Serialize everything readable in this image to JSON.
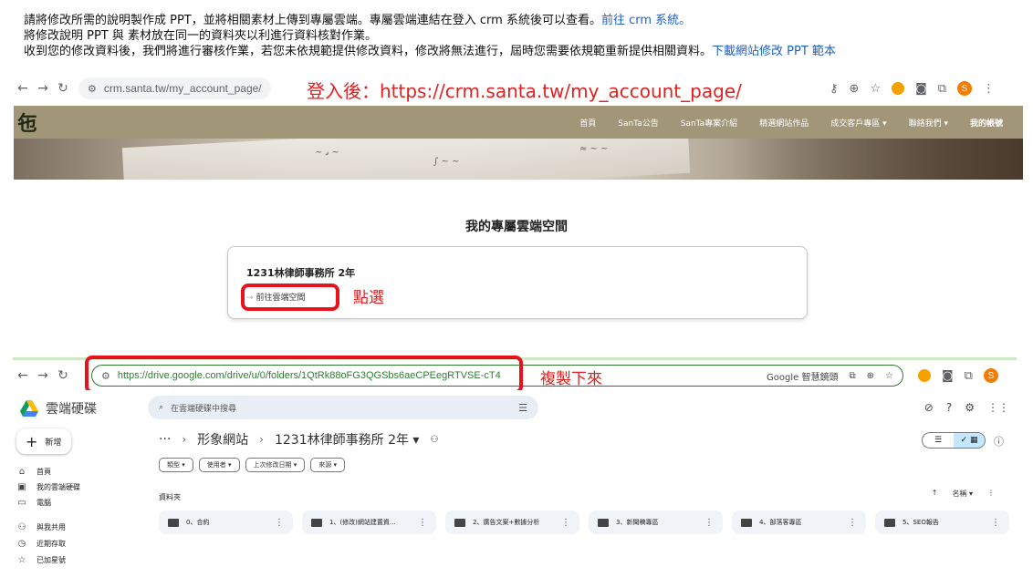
{
  "instructions": {
    "line1_text": "請將修改所需的說明製作成 PPT，並將相關素材上傳到專屬雲端。專屬雲端連結在登入 crm 系統後可以查看。",
    "line1_link": "前往 crm 系統。",
    "line2_text": "將修改說明 PPT 與 素材放在同一的資料夾以利進行資料核對作業。",
    "line3_text": "收到您的修改資料後，我們將進行審核作業，若您未依規範提供修改資料，修改將無法進行，屆時您需要依規範重新提供相關資料。",
    "line3_link": "下載網站修改 PPT 範本"
  },
  "crm_browser": {
    "url": "crm.santa.tw/my_account_page/",
    "annotation": "登入後：https://crm.santa.tw/my_account_page/",
    "avatar_letter": "S"
  },
  "santa_site": {
    "logo": "㐌",
    "menu": [
      "首頁",
      "SanTa公告",
      "SanTa專案介紹",
      "精選網站作品",
      "成交客戶專區 ▾",
      "聯絡我們 ▾",
      "我的帳號"
    ],
    "hero_scribbles": [
      "~ 𝓈 ~",
      "∫ ~ ~",
      "≈ ~ ~"
    ],
    "section_title": "我的專屬雲端空間",
    "card_title": "1231林律師事務所 2年",
    "card_link": "前往雲端空間",
    "card_annotation": "點選"
  },
  "drive_browser": {
    "url": "https://drive.google.com/drive/u/0/folders/1QtRk88oFG3QGSbs6aeCPEegRTVSE-cT4",
    "annotation": "複製下來",
    "google_search": "Google 智慧鏡頭",
    "avatar_letter": "S"
  },
  "drive": {
    "app_name": "雲端硬碟",
    "search_placeholder": "在雲端硬碟中搜尋",
    "new_label": "新增",
    "sidebar": [
      {
        "icon": "⌂",
        "label": "首頁"
      },
      {
        "icon": "▣",
        "label": "我的雲端硬碟"
      },
      {
        "icon": "▭",
        "label": "電腦"
      },
      {
        "icon": "⚇",
        "label": "與我共用"
      },
      {
        "icon": "◷",
        "label": "近期存取"
      },
      {
        "icon": "☆",
        "label": "已加星號"
      }
    ],
    "breadcrumb": [
      "···",
      "形象網站",
      "1231林律師事務所 2年 ▾"
    ],
    "filters": [
      "類型 ▾",
      "使用者 ▾",
      "上次修改日期 ▾",
      "來源 ▾"
    ],
    "folders_label": "資料夾",
    "sort_label": "名稱 ▾",
    "folders": [
      "0、合約",
      "1、(修改)網站建置資...",
      "2、廣告文案+數據分析",
      "3、新聞稿專區",
      "4、部落客專區",
      "5、SEO報告"
    ],
    "colors": {
      "search_bg": "#e9eef6",
      "folder_bg": "#f0f4f9",
      "toggle_active": "#c2e7ff"
    }
  },
  "colors": {
    "annotation_red": "#e32020",
    "link_blue": "#1a5fd0",
    "santa_nav": "#a29679",
    "drive_url_border": "#2f7a2f"
  }
}
